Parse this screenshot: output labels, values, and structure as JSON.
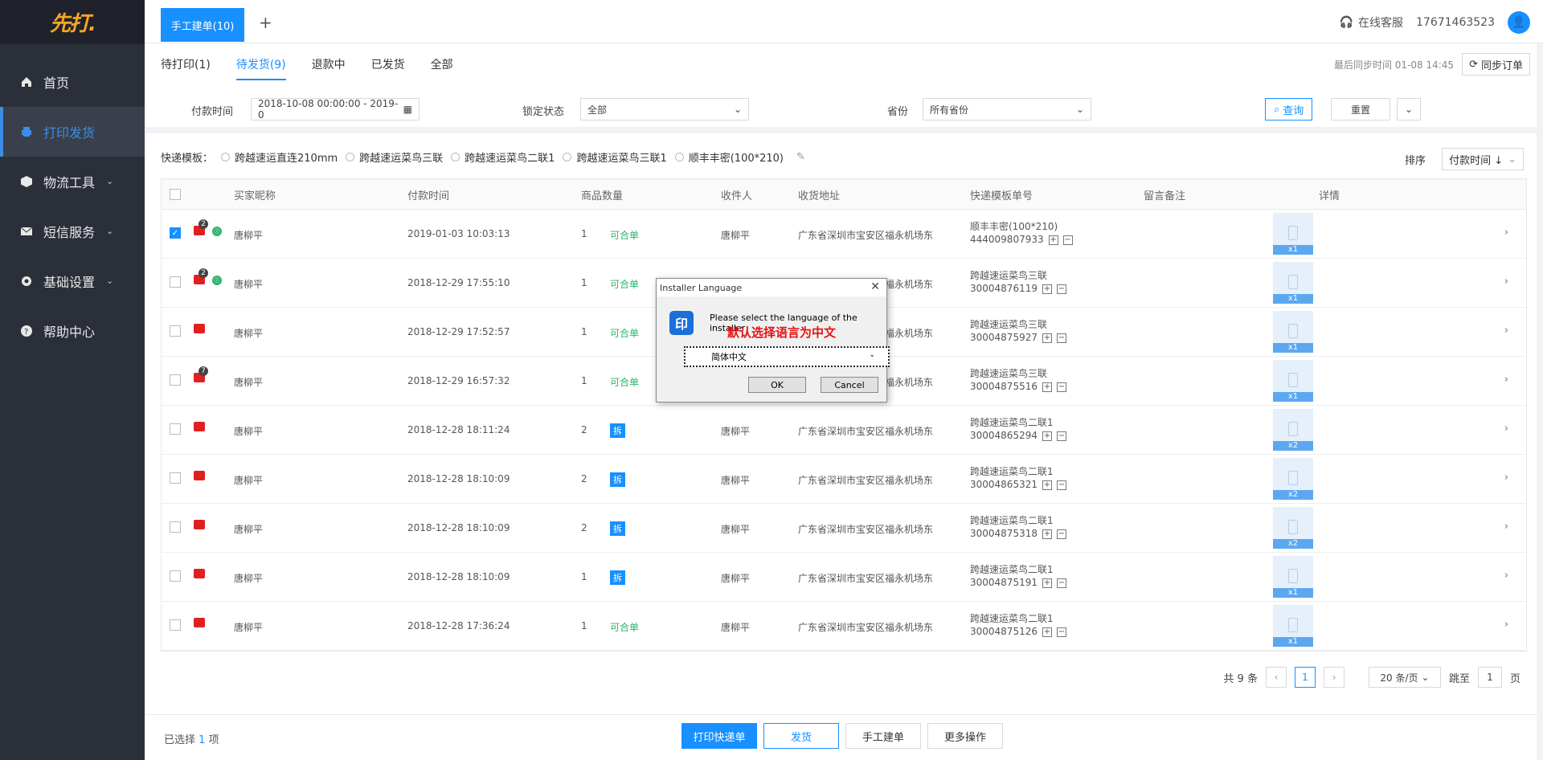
{
  "app": {
    "logo": "先打."
  },
  "sidebar": {
    "items": [
      {
        "label": "首页",
        "icon": "home-icon"
      },
      {
        "label": "打印发货",
        "icon": "printer-icon",
        "active": true
      },
      {
        "label": "物流工具",
        "icon": "box-icon",
        "expandable": true
      },
      {
        "label": "短信服务",
        "icon": "mail-icon",
        "expandable": true
      },
      {
        "label": "基础设置",
        "icon": "gear-icon",
        "expandable": true
      },
      {
        "label": "帮助中心",
        "icon": "help-icon"
      }
    ]
  },
  "topbar": {
    "tab": "手工建单(10)",
    "add_tab": "+",
    "support": "在线客服",
    "phone": "17671463523"
  },
  "subtabs": [
    "待打印(1)",
    "待发货(9)",
    "退款中",
    "已发货",
    "全部"
  ],
  "sync": {
    "last_sync": "最后同步时间 01-08 14:45",
    "button": "同步订单"
  },
  "filters": {
    "pay_time_label": "付款时间",
    "pay_time_value": "2018-10-08 00:00:00 - 2019-0",
    "lock_label": "锁定状态",
    "lock_value": "全部",
    "province_label": "省份",
    "province_value": "所有省份",
    "query": "查询",
    "reset": "重置"
  },
  "templates": {
    "label": "快递模板：",
    "options": [
      "跨越速运直连210mm",
      "跨越速运菜鸟三联",
      "跨越速运菜鸟二联1",
      "跨越速运菜鸟三联1",
      "顺丰丰密(100*210)"
    ]
  },
  "sort": {
    "label": "排序",
    "value": "付款时间 ↓"
  },
  "table": {
    "headers": [
      "买家昵称",
      "付款时间",
      "商品数量",
      "收件人",
      "收货地址",
      "快递模板单号",
      "留言备注",
      "详情"
    ],
    "rows": [
      {
        "checked": true,
        "badge": "2",
        "green": true,
        "buyer": "唐柳平",
        "time": "2019-01-03 10:03:13",
        "qty": "1",
        "tag": "可合单",
        "recv": "唐柳平",
        "addr": "广东省深圳市宝安区福永机场东",
        "tpl": "顺丰丰密(100*210)",
        "no": "444009807933",
        "count": "x1"
      },
      {
        "checked": false,
        "badge": "2",
        "green": true,
        "buyer": "唐柳平",
        "time": "2018-12-29 17:55:10",
        "qty": "1",
        "tag": "可合单",
        "recv": "",
        "addr": "广东省深圳市宝安区福永机场东",
        "tpl": "跨越速运菜鸟三联",
        "no": "30004876119",
        "count": "x1"
      },
      {
        "checked": false,
        "badge": "",
        "green": false,
        "buyer": "唐柳平",
        "time": "2018-12-29 17:52:57",
        "qty": "1",
        "tag": "可合单",
        "recv": "",
        "addr": "广东省深圳市宝安区福永机场东",
        "tpl": "跨越速运菜鸟三联",
        "no": "30004875927",
        "count": "x1"
      },
      {
        "checked": false,
        "badge": "7",
        "green": false,
        "buyer": "唐柳平",
        "time": "2018-12-29 16:57:32",
        "qty": "1",
        "tag": "可合单",
        "recv": "",
        "addr": "广东省深圳市宝安区福永机场东",
        "tpl": "跨越速运菜鸟三联",
        "no": "30004875516",
        "count": "x1"
      },
      {
        "checked": false,
        "badge": "",
        "green": false,
        "buyer": "唐柳平",
        "time": "2018-12-28 18:11:24",
        "qty": "2",
        "tag": "拆",
        "recv": "唐柳平",
        "addr": "广东省深圳市宝安区福永机场东",
        "tpl": "跨越速运菜鸟二联1",
        "no": "30004865294",
        "count": "x2"
      },
      {
        "checked": false,
        "badge": "",
        "green": false,
        "buyer": "唐柳平",
        "time": "2018-12-28 18:10:09",
        "qty": "2",
        "tag": "拆",
        "recv": "唐柳平",
        "addr": "广东省深圳市宝安区福永机场东",
        "tpl": "跨越速运菜鸟二联1",
        "no": "30004865321",
        "count": "x2"
      },
      {
        "checked": false,
        "badge": "",
        "green": false,
        "buyer": "唐柳平",
        "time": "2018-12-28 18:10:09",
        "qty": "2",
        "tag": "拆",
        "recv": "唐柳平",
        "addr": "广东省深圳市宝安区福永机场东",
        "tpl": "跨越速运菜鸟二联1",
        "no": "30004875318",
        "count": "x2"
      },
      {
        "checked": false,
        "badge": "",
        "green": false,
        "buyer": "唐柳平",
        "time": "2018-12-28 18:10:09",
        "qty": "1",
        "tag": "拆",
        "recv": "唐柳平",
        "addr": "广东省深圳市宝安区福永机场东",
        "tpl": "跨越速运菜鸟二联1",
        "no": "30004875191",
        "count": "x1"
      },
      {
        "checked": false,
        "badge": "",
        "green": false,
        "buyer": "唐柳平",
        "time": "2018-12-28 17:36:24",
        "qty": "1",
        "tag": "可合单",
        "recv": "唐柳平",
        "addr": "广东省深圳市宝安区福永机场东",
        "tpl": "跨越速运菜鸟二联1",
        "no": "30004875126",
        "count": "x1"
      }
    ]
  },
  "pager": {
    "total": "共 9 条",
    "current": "1",
    "size": "20 条/页",
    "jump": "跳至",
    "jump_value": "1",
    "page": "页"
  },
  "footer": {
    "selected_prefix": "已选择",
    "selected_count": "1",
    "selected_suffix": "项",
    "print": "打印快递单",
    "ship": "发货",
    "manual": "手工建单",
    "more": "更多操作"
  },
  "dialog": {
    "title": "Installer Language",
    "message": "Please select the language of the installer",
    "note": "默认选择语言为中文",
    "selected": "简体中文",
    "ok": "OK",
    "cancel": "Cancel",
    "icon_char": "印"
  },
  "colors": {
    "accent": "#1890ff",
    "sidebar": "#2b2f3a",
    "merge": "#2db36a",
    "note": "#e81010"
  }
}
